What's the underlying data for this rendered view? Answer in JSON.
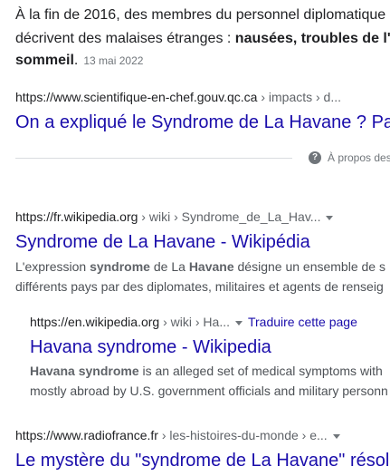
{
  "top_snippet": {
    "line1": "À la fin de 2016, des membres du personnel diplomatique",
    "line2_prefix": "décrivent des malaises étranges : ",
    "line2_bold": "nausées, troubles de l'",
    "line3_bold": "sommeil",
    "line3_suffix": ".",
    "date": "13 mai 2022"
  },
  "result1": {
    "url": "https://www.scientifique-en-chef.gouv.qc.ca",
    "crumbs": " › impacts › d...",
    "title": "On a expliqué le Syndrome de La Havane ? Pa"
  },
  "about": {
    "label": "À propos des"
  },
  "result2": {
    "url": "https://fr.wikipedia.org",
    "crumbs": " › wiki › Syndrome_de_La_Hav...",
    "title": "Syndrome de La Havane - Wikipédia",
    "desc1_a": "L'expression ",
    "desc1_b": "syndrome",
    "desc1_c": " de La ",
    "desc1_d": "Havane",
    "desc1_e": " désigne un ensemble de s",
    "desc2": "différents pays par des diplomates, militaires et agents de renseig"
  },
  "result3": {
    "url": "https://en.wikipedia.org",
    "crumbs": " › wiki › Ha...",
    "translate": "Traduire cette page",
    "title": "Havana syndrome - Wikipedia",
    "desc1_a": "Havana syndrome",
    "desc1_b": " is an alleged set of medical symptoms with",
    "desc2": "mostly abroad by U.S. government officials and military personn"
  },
  "result4": {
    "url": "https://www.radiofrance.fr",
    "crumbs": " › les-histoires-du-monde › e...",
    "title": "Le mystère du \"syndrome de La Havane\" résol"
  },
  "colors": {
    "link": "#1a0dab",
    "text": "#202124",
    "muted": "#70757a"
  },
  "icons": [
    "help-icon",
    "caret-down-icon"
  ]
}
